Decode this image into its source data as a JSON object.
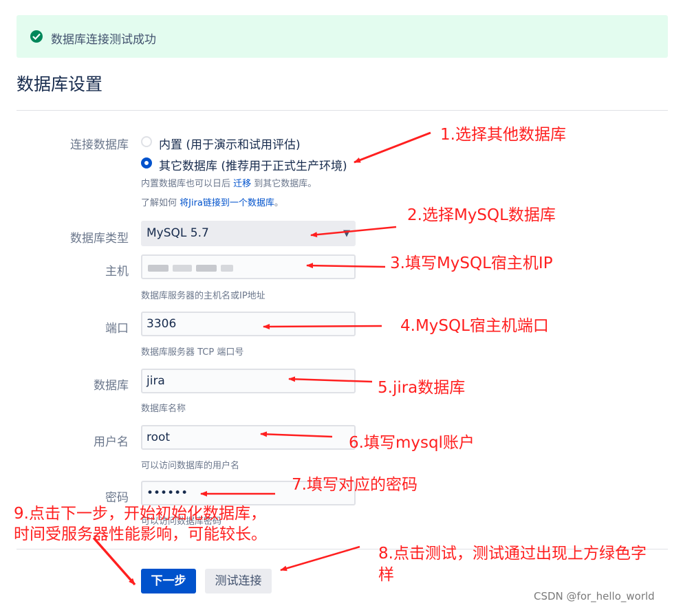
{
  "banner": {
    "message": "数据库连接测试成功",
    "color": "#e3fcef"
  },
  "title": "数据库设置",
  "connection": {
    "label": "连接数据库",
    "options": [
      {
        "label": "内置 (用于演示和试用评估)",
        "selected": false
      },
      {
        "label": "其它数据库 (推荐用于正式生产环境)",
        "selected": true
      }
    ],
    "help1_prefix": "内置数据库也可以日后 ",
    "help1_link": "迁移",
    "help1_suffix": " 到其它数据库。",
    "help2_prefix": "了解如何 ",
    "help2_link": "将Jira链接到一个数据库",
    "help2_suffix": "。"
  },
  "db_type": {
    "label": "数据库类型",
    "value": "MySQL 5.7"
  },
  "host": {
    "label": "主机",
    "value": "",
    "help": "数据库服务器的主机名或IP地址"
  },
  "port": {
    "label": "端口",
    "value": "3306",
    "help": "数据库服务器 TCP 端口号"
  },
  "database": {
    "label": "数据库",
    "value": "jira",
    "help": "数据库名称"
  },
  "username": {
    "label": "用户名",
    "value": "root",
    "help": "可以访问数据库的用户名"
  },
  "password": {
    "label": "密码",
    "value": "••••••",
    "help": "可以访问数据库密码"
  },
  "buttons": {
    "next": "下一步",
    "test": "测试连接"
  },
  "annotations": {
    "a1": "1.选择其他数据库",
    "a2": "2.选择MySQL数据库",
    "a3": "3.填写MySQL宿主机IP",
    "a4": "4.MySQL宿主机端口",
    "a5": "5.jira数据库",
    "a6": "6.填写mysql账户",
    "a7": "7.填写对应的密码",
    "a8_line1": "8.点击测试，测试通过出现上方绿色字",
    "a8_line2": "样",
    "a9_line1": "9.点击下一步，开始初始化数据库，",
    "a9_line2": "时间受服务器性能影响，可能较长。"
  },
  "watermark": "CSDN @for_hello_world",
  "colors": {
    "primary": "#0052cc",
    "annotation": "#ff1f1f",
    "success": "#00875a"
  }
}
